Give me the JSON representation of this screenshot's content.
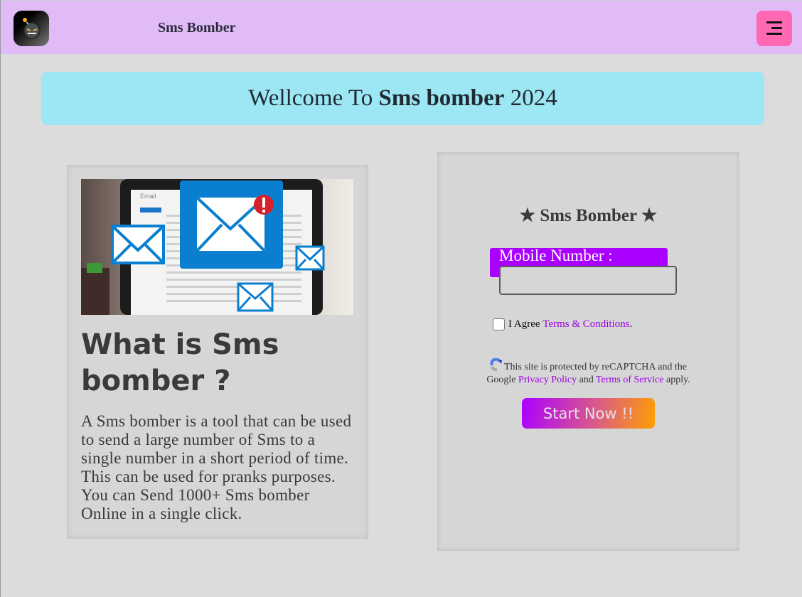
{
  "navbar": {
    "logo_icon": "bomb-icon",
    "title": "Sms Bomber",
    "menu_icon": "hamburger-menu-icon"
  },
  "welcome": {
    "prefix": "Wellcome To ",
    "bold": "Sms bomber",
    "suffix": " 2024"
  },
  "info": {
    "image_alt": "Email envelopes over laptop inbox",
    "image_screen_label": "Email",
    "title": "What is Sms bomber ?",
    "text": "A Sms bomber is a tool that can be used to send a large number of Sms to a single number in a short period of time. This can be used for pranks purposes. You can Send 1000+ Sms bomber Online in a single click."
  },
  "form": {
    "title": "★ Sms Bomber ★",
    "mobile_label": "Mobile Number :",
    "mobile_value": "",
    "agree_text": "I Agree ",
    "terms_link": "Terms & Conditions",
    "agree_suffix": ".",
    "recaptcha_line1": "This site is protected by reCAPTCHA and the",
    "recaptcha_google": "Google ",
    "privacy_link": "Privacy Policy",
    "and": " and ",
    "tos_link": "Terms of Service",
    "apply": " apply.",
    "start_button": "Start Now !!"
  },
  "colors": {
    "navbar_bg": "#e1bbf7",
    "menu_button": "#ff69b4",
    "welcome_bg": "#9de6f3",
    "label_bg": "#aa00ff",
    "link": "#9900dd",
    "button_gradient_start": "#aa00ff",
    "button_gradient_end": "#ff9f00"
  }
}
